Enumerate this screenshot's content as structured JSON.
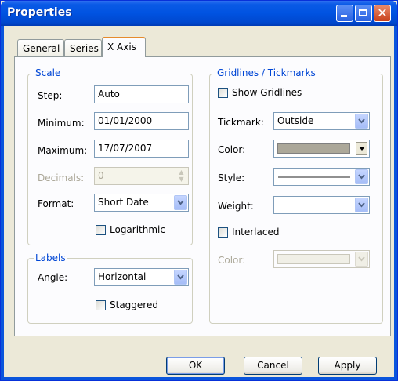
{
  "window": {
    "title": "Properties"
  },
  "tabs": [
    {
      "label": "General"
    },
    {
      "label": "Series"
    },
    {
      "label": "X Axis"
    }
  ],
  "scale": {
    "legend": "Scale",
    "step_label": "Step:",
    "step_value": "Auto",
    "minimum_label": "Minimum:",
    "minimum_value": "01/01/2000",
    "maximum_label": "Maximum:",
    "maximum_value": "17/07/2007",
    "decimals_label": "Decimals:",
    "decimals_value": "0",
    "format_label": "Format:",
    "format_value": "Short Date",
    "logarithmic_label": "Logarithmic",
    "logarithmic_checked": false
  },
  "labels": {
    "legend": "Labels",
    "angle_label": "Angle:",
    "angle_value": "Horizontal",
    "staggered_label": "Staggered",
    "staggered_checked": false
  },
  "gridlines": {
    "legend": "Gridlines / Tickmarks",
    "show_gridlines_label": "Show Gridlines",
    "show_gridlines_checked": false,
    "tickmark_label": "Tickmark:",
    "tickmark_value": "Outside",
    "color_label": "Color:",
    "color_value": "#aca899",
    "style_label": "Style:",
    "weight_label": "Weight:",
    "interlaced_label": "Interlaced",
    "interlaced_checked": false,
    "interlaced_color_label": "Color:"
  },
  "buttons": {
    "ok": "OK",
    "cancel": "Cancel",
    "apply": "Apply"
  }
}
